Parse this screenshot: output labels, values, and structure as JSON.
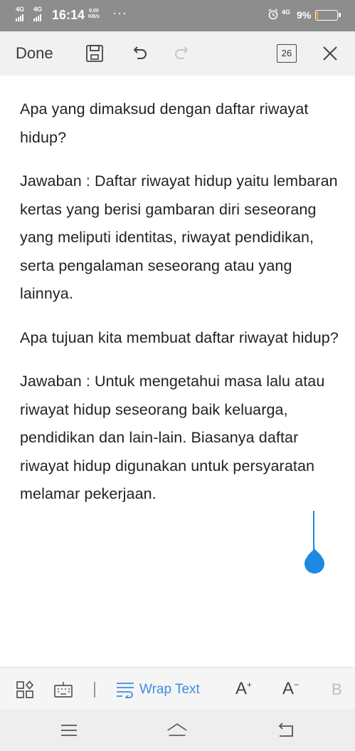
{
  "status_bar": {
    "net1": "4G",
    "net2": "4G",
    "time": "16:14",
    "speed_value": "0.00",
    "speed_unit": "KB/s",
    "more": "···",
    "net3": "4G",
    "battery_percent": "9%",
    "battery_level": 0.09
  },
  "toolbar": {
    "done_label": "Done",
    "page_count": "26"
  },
  "document": {
    "paragraphs": [
      "Apa yang dimaksud dengan daftar riwayat hidup?",
      "Jawaban : Daftar riwayat hidup yaitu lembaran kertas yang berisi gambaran diri seseorang yang meliputi identitas, riwayat pendidikan, serta pengalaman seseorang atau yang lainnya.",
      "Apa tujuan kita membuat daftar riwayat hidup?",
      "Jawaban : Untuk mengetahui masa lalu atau riwayat hidup seseorang baik keluarga, pendidikan dan lain-lain. Biasanya daftar riwayat hidup digunakan untuk persyaratan melamar pekerjaan."
    ]
  },
  "edit_bar": {
    "wrap_text_label": "Wrap Text",
    "font_increase_label": "A",
    "font_decrease_label": "A",
    "bold_label": "B"
  },
  "colors": {
    "accent": "#1e88e5",
    "status_bar_bg": "#8d8d8d",
    "battery_low": "#f5a623"
  },
  "icons": {
    "toolbar": [
      "save-icon",
      "undo-icon",
      "redo-icon",
      "close-icon"
    ],
    "edit_bar": [
      "grid-apps-icon",
      "keyboard-icon",
      "wrap-text-icon"
    ],
    "nav": [
      "menu-icon",
      "home-icon",
      "back-icon"
    ]
  }
}
